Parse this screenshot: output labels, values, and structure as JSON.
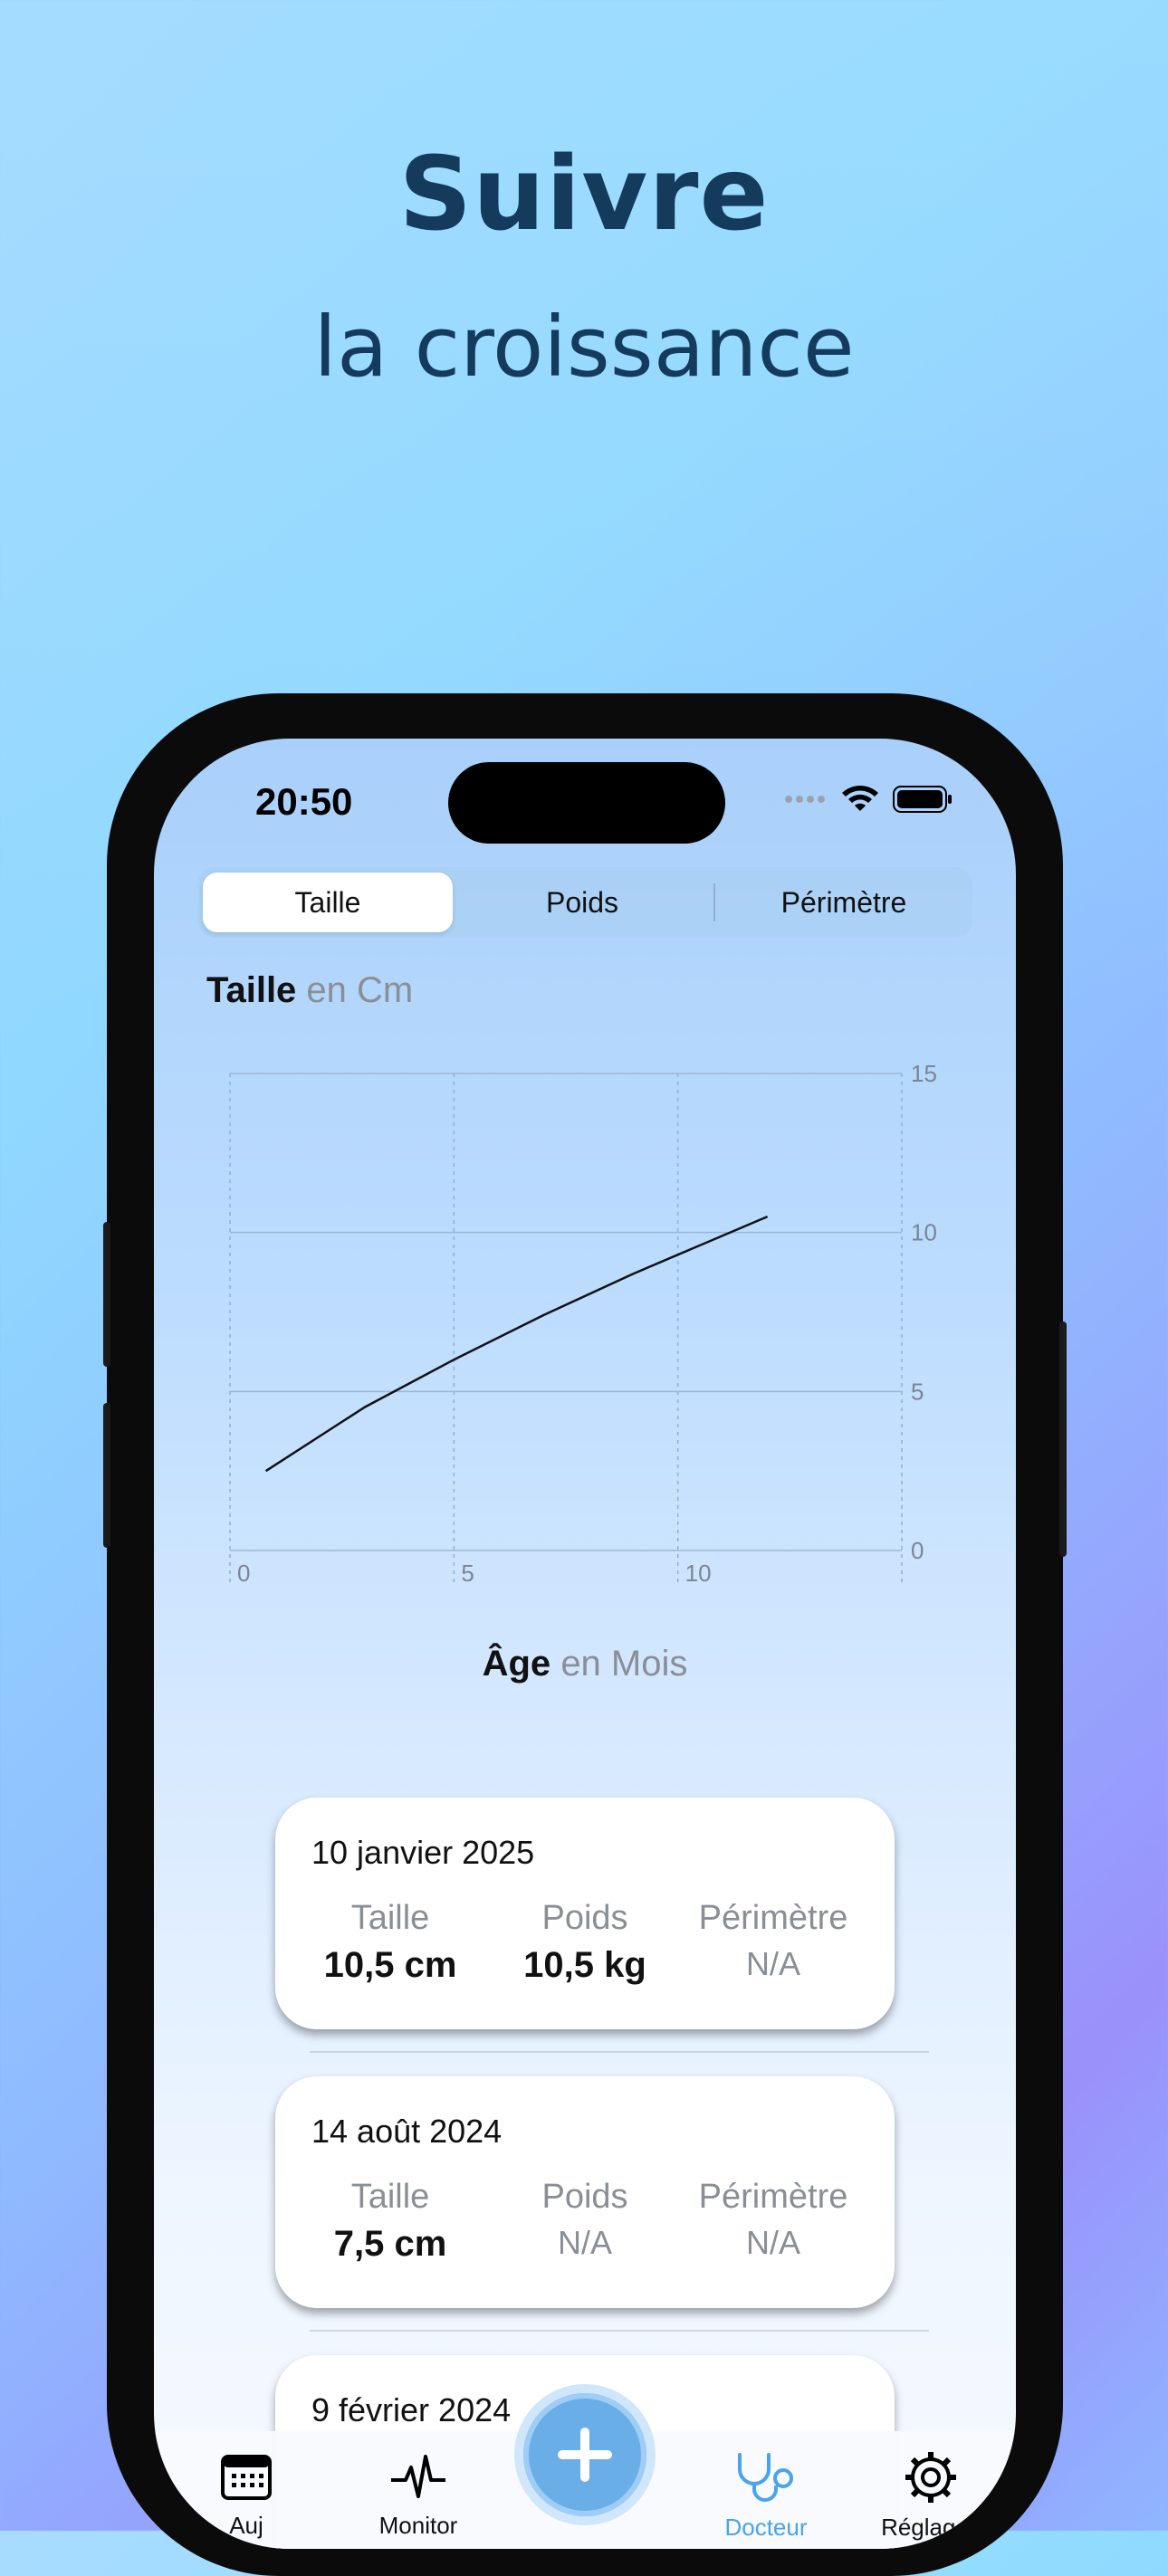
{
  "headline": {
    "title": "Suivre",
    "subtitle": "la croissance"
  },
  "status_bar": {
    "time": "20:50"
  },
  "segmented": {
    "items": [
      "Taille",
      "Poids",
      "Périmètre"
    ],
    "selected": "Taille"
  },
  "chart_header": {
    "label": "Taille",
    "unit": "en Cm"
  },
  "x_header": {
    "label": "Âge",
    "unit": "en Mois"
  },
  "chart_data": {
    "type": "line",
    "x": [
      0.8,
      3,
      5,
      7,
      9,
      12
    ],
    "y": [
      2.5,
      4.5,
      6.0,
      7.4,
      8.7,
      10.5
    ],
    "xlim": [
      0,
      15
    ],
    "ylim": [
      0,
      15
    ],
    "xticks": [
      "0",
      "5",
      "10"
    ],
    "yticks": [
      "15",
      "10",
      "5",
      "0"
    ],
    "grid": true
  },
  "entries": [
    {
      "date": "10 janvier 2025",
      "taille_label": "Taille",
      "taille": "10,5 cm",
      "poids_label": "Poids",
      "poids": "10,5 kg",
      "perimetre_label": "Périmètre",
      "perimetre": "N/A"
    },
    {
      "date": "14 août 2024",
      "taille_label": "Taille",
      "taille": "7,5 cm",
      "poids_label": "Poids",
      "poids": "N/A",
      "perimetre_label": "Périmètre",
      "perimetre": "N/A"
    },
    {
      "date": "9 février 2024"
    }
  ],
  "tabbar": {
    "items": [
      {
        "label": "Auj",
        "icon": "calendar-icon"
      },
      {
        "label": "Monitor",
        "icon": "heartbeat-icon"
      },
      {
        "label": "Docteur",
        "icon": "stethoscope-icon",
        "active": true
      },
      {
        "label": "Réglages",
        "icon": "gear-icon"
      }
    ],
    "add_icon": "plus-icon"
  },
  "colors": {
    "accent": "#4aa3ee",
    "headline": "#143a5c"
  }
}
